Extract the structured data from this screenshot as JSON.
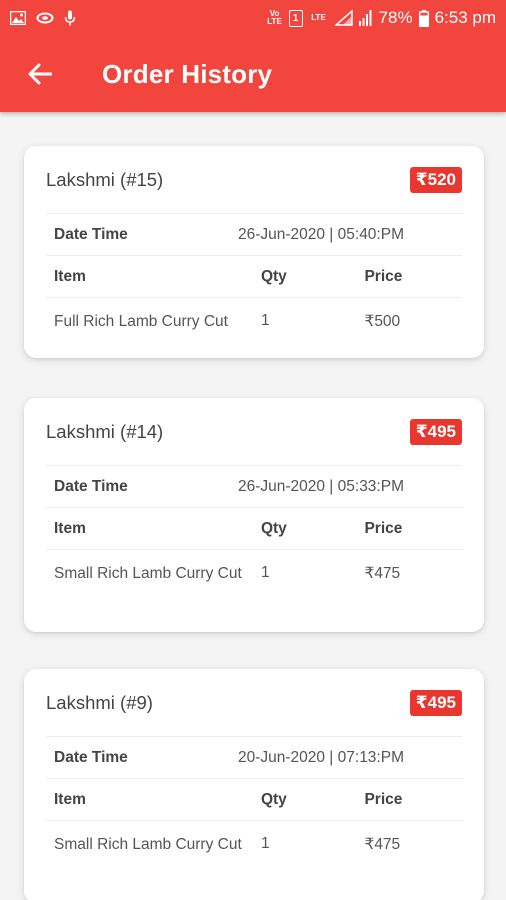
{
  "status_bar": {
    "battery": "78%",
    "time": "6:53 pm",
    "sim_label": "1",
    "volte_label": "Vo LTE",
    "lte_label": "LTE"
  },
  "header": {
    "title": "Order History"
  },
  "labels": {
    "date_time": "Date Time",
    "item": "Item",
    "qty": "Qty",
    "price": "Price"
  },
  "colors": {
    "accent": "#f2453d",
    "badge": "#e8372f"
  },
  "orders": [
    {
      "customer": "Lakshmi (#15)",
      "total": "₹520",
      "date_time": "26-Jun-2020 | 05:40:PM",
      "items": [
        {
          "name": "Full Rich Lamb Curry Cut",
          "qty": "1",
          "price": "₹500"
        }
      ]
    },
    {
      "customer": "Lakshmi (#14)",
      "total": "₹495",
      "date_time": "26-Jun-2020 | 05:33:PM",
      "items": [
        {
          "name": "Small Rich Lamb Curry Cut",
          "qty": "1",
          "price": "₹475"
        }
      ]
    },
    {
      "customer": "Lakshmi (#9)",
      "total": "₹495",
      "date_time": "20-Jun-2020 | 07:13:PM",
      "items": [
        {
          "name": "Small Rich Lamb Curry Cut",
          "qty": "1",
          "price": "₹475"
        }
      ]
    }
  ]
}
